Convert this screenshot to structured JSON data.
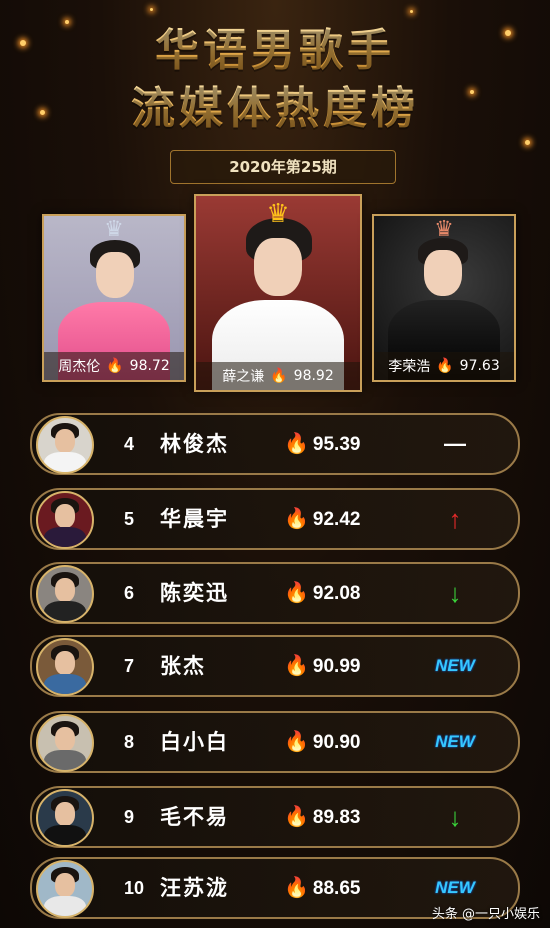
{
  "header": {
    "title_line1": "华语男歌手",
    "title_line2": "流媒体热度榜",
    "issue": "2020年第25期"
  },
  "top3": [
    {
      "rank": 2,
      "name": "周杰伦",
      "score": "98.72",
      "crown": "silver"
    },
    {
      "rank": 1,
      "name": "薛之谦",
      "score": "98.92",
      "crown": "gold"
    },
    {
      "rank": 3,
      "name": "李荣浩",
      "score": "97.63",
      "crown": "bronze"
    }
  ],
  "ranking": [
    {
      "rank": "4",
      "name": "林俊杰",
      "score": "95.39",
      "trend": "—",
      "trend_type": "flat"
    },
    {
      "rank": "5",
      "name": "华晨宇",
      "score": "92.42",
      "trend": "↑",
      "trend_type": "up"
    },
    {
      "rank": "6",
      "name": "陈奕迅",
      "score": "92.08",
      "trend": "↓",
      "trend_type": "down"
    },
    {
      "rank": "7",
      "name": "张杰",
      "score": "90.99",
      "trend": "NEW",
      "trend_type": "new"
    },
    {
      "rank": "8",
      "name": "白小白",
      "score": "90.90",
      "trend": "NEW",
      "trend_type": "new"
    },
    {
      "rank": "9",
      "name": "毛不易",
      "score": "89.83",
      "trend": "↓",
      "trend_type": "down"
    },
    {
      "rank": "10",
      "name": "汪苏泷",
      "score": "88.65",
      "trend": "NEW",
      "trend_type": "new"
    }
  ],
  "icons": {
    "score": "fire-icon",
    "crown": "crown-icon"
  },
  "colors": {
    "accent_gold": "#d7b36a",
    "up": "#e62a2a",
    "down": "#3ad13a",
    "new": "#36c8ff"
  },
  "watermark": "头条 @一只小娱乐"
}
